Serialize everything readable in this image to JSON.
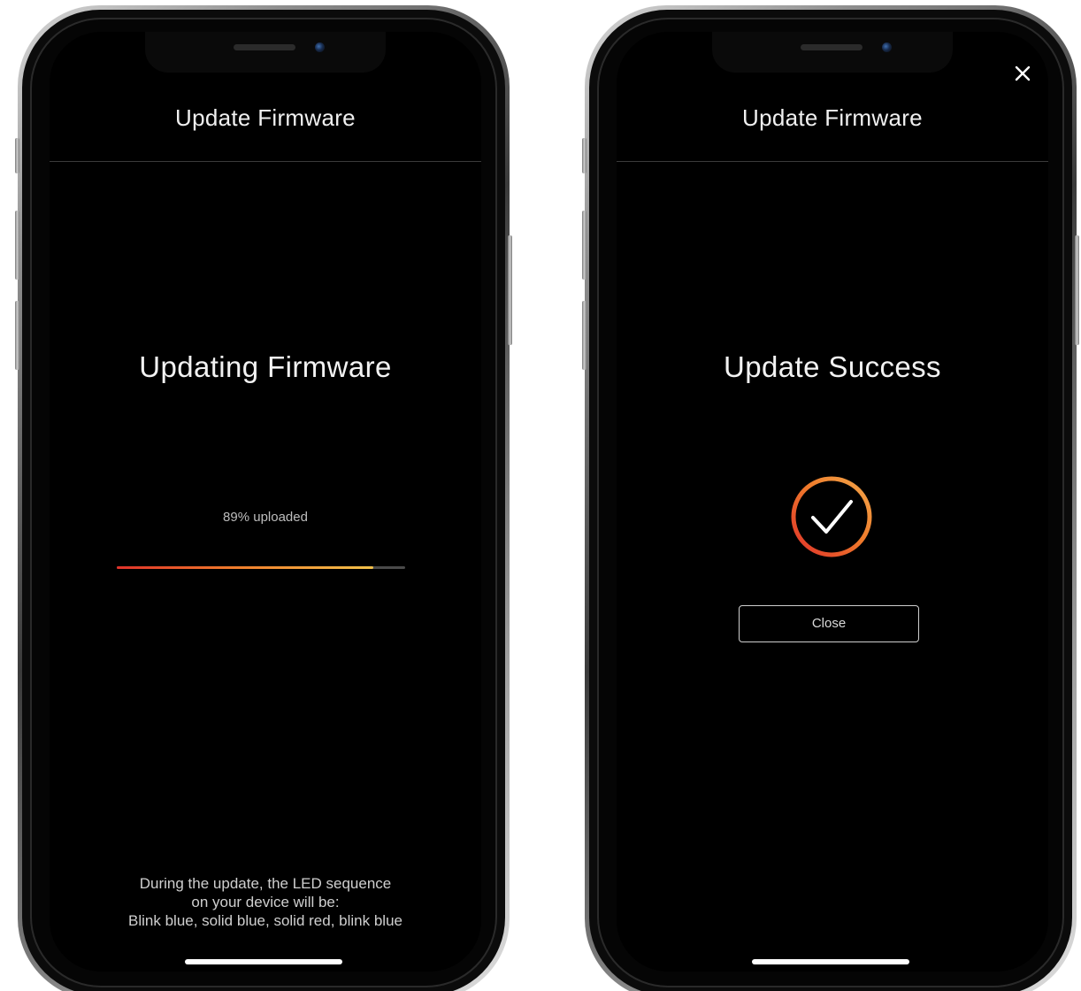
{
  "updating_screen": {
    "header_title": "Update Firmware",
    "title": "Updating Firmware",
    "progress_label": "89% uploaded",
    "progress_percent": 89,
    "note_lines": [
      "During the update, the LED sequence",
      "on your device will be:",
      "Blink blue, solid blue, solid red, blink blue"
    ]
  },
  "success_screen": {
    "header_title": "Update Firmware",
    "title": "Update Success",
    "close_button_label": "Close",
    "close_icon": "close-icon",
    "status_icon": "check-circle-icon"
  },
  "colors": {
    "background": "#000000",
    "accent_start": "#e0322a",
    "accent_mid": "#ef7b2b",
    "accent_end": "#f2c14a"
  }
}
